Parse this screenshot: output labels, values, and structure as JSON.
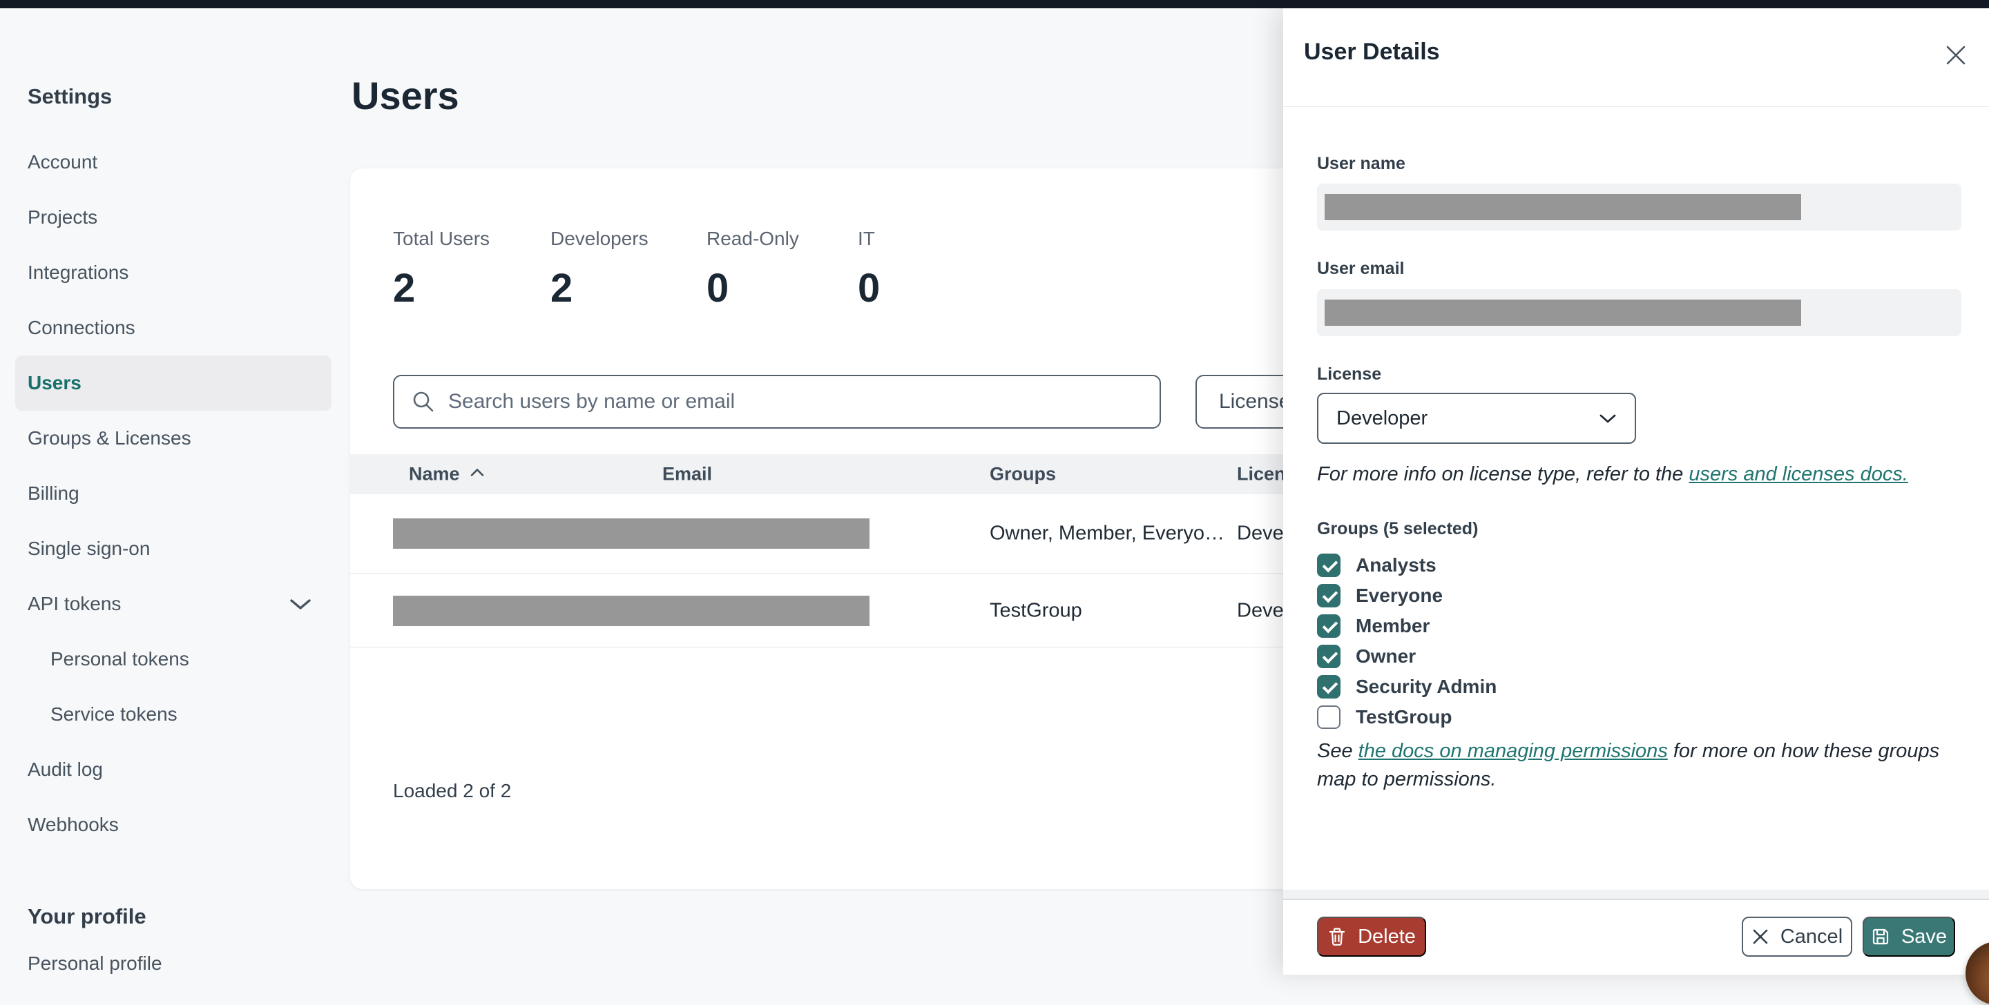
{
  "sidebar": {
    "section_title": "Settings",
    "items": [
      {
        "label": "Account",
        "active": false
      },
      {
        "label": "Projects",
        "active": false
      },
      {
        "label": "Integrations",
        "active": false
      },
      {
        "label": "Connections",
        "active": false
      },
      {
        "label": "Users",
        "active": true
      },
      {
        "label": "Groups & Licenses",
        "active": false
      },
      {
        "label": "Billing",
        "active": false
      },
      {
        "label": "Single sign-on",
        "active": false
      },
      {
        "label": "API tokens",
        "active": false,
        "expandable": true
      },
      {
        "label": "Personal tokens",
        "active": false,
        "child": true
      },
      {
        "label": "Service tokens",
        "active": false,
        "child": true
      },
      {
        "label": "Audit log",
        "active": false
      },
      {
        "label": "Webhooks",
        "active": false
      }
    ],
    "profile_section_title": "Your profile",
    "profile_items": [
      {
        "label": "Personal profile"
      }
    ]
  },
  "main": {
    "page_title": "Users",
    "stats": [
      {
        "label": "Total Users",
        "value": "2"
      },
      {
        "label": "Developers",
        "value": "2"
      },
      {
        "label": "Read-Only",
        "value": "0"
      },
      {
        "label": "IT",
        "value": "0"
      }
    ],
    "search": {
      "placeholder": "Search users by name or email",
      "value": ""
    },
    "license_filter_label": "License",
    "table": {
      "columns": [
        "Name",
        "Email",
        "Groups",
        "License"
      ],
      "sorted_column": "Name",
      "sort_direction": "ascending",
      "rows": [
        {
          "name_redacted": true,
          "email_redacted": true,
          "groups": "Owner, Member, Everyo…",
          "license": "Developer"
        },
        {
          "name_redacted": true,
          "email_redacted": true,
          "groups": "TestGroup",
          "license": "Developer"
        }
      ]
    },
    "footer_status": "Loaded 2 of 2"
  },
  "panel": {
    "title": "User Details",
    "user_name_label": "User name",
    "user_name_redacted": true,
    "user_email_label": "User email",
    "user_email_redacted": true,
    "license": {
      "label": "License",
      "selected_value": "Developer"
    },
    "license_info": {
      "prefix": "For more info on license type, refer to the ",
      "link_text": "users and licenses docs."
    },
    "groups": {
      "label": "Groups (5 selected)",
      "options": [
        {
          "label": "Analysts",
          "checked": true
        },
        {
          "label": "Everyone",
          "checked": true
        },
        {
          "label": "Member",
          "checked": true
        },
        {
          "label": "Owner",
          "checked": true
        },
        {
          "label": "Security Admin",
          "checked": true
        },
        {
          "label": "TestGroup",
          "checked": false
        }
      ]
    },
    "permissions_note": {
      "prefix": "See ",
      "link_text": "the docs on managing permissions",
      "suffix": " for more on how these groups map to permissions."
    },
    "buttons": {
      "delete": "Delete",
      "cancel": "Cancel",
      "save": "Save"
    }
  },
  "colors": {
    "accent_teal": "#2f716f",
    "save_teal": "#3a7876",
    "link_teal": "#1f756f",
    "delete_red": "#a83c30",
    "topbar_dark": "#141a25",
    "redaction_gray": "#979797"
  }
}
